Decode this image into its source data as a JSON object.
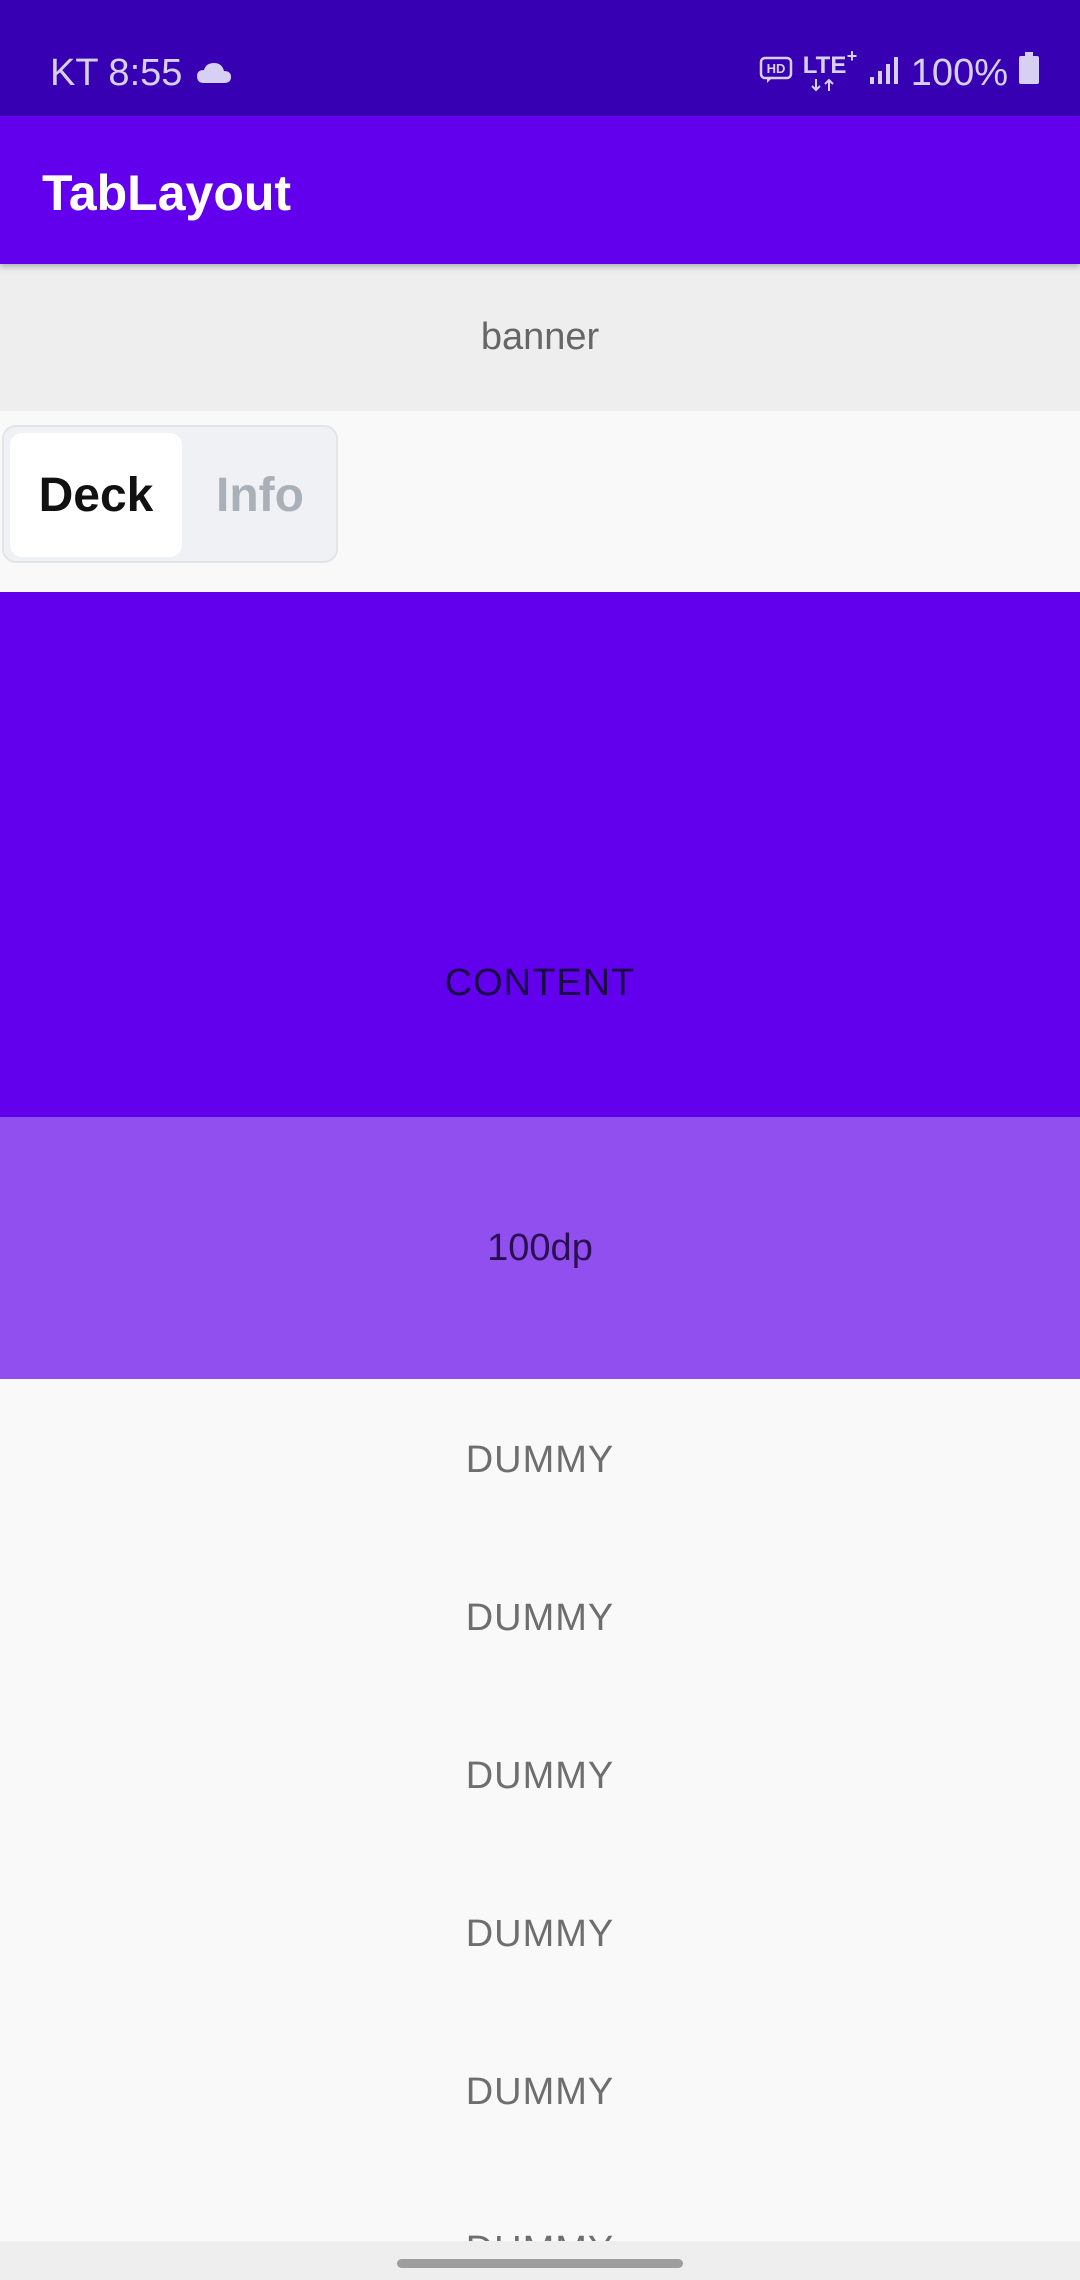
{
  "status_bar": {
    "carrier_time": "KT 8:55",
    "network": "LTE",
    "network_plus": "+",
    "battery": "100%",
    "icons": [
      "cloud-icon",
      "hd-icon",
      "lte-icon",
      "signal-icon",
      "battery-icon"
    ]
  },
  "app_bar": {
    "title": "TabLayout"
  },
  "banner": {
    "label": "banner"
  },
  "tabs": [
    {
      "label": "Deck",
      "selected": true
    },
    {
      "label": "Info",
      "selected": false
    }
  ],
  "content": {
    "label": "CONTENT"
  },
  "block": {
    "label": "100dp"
  },
  "dummy_items": [
    "DUMMY",
    "DUMMY",
    "DUMMY",
    "DUMMY",
    "DUMMY",
    "DUMMY"
  ],
  "colors": {
    "status_bar": "#3700b3",
    "primary": "#6200ee",
    "secondary_block": "#914ff0"
  }
}
